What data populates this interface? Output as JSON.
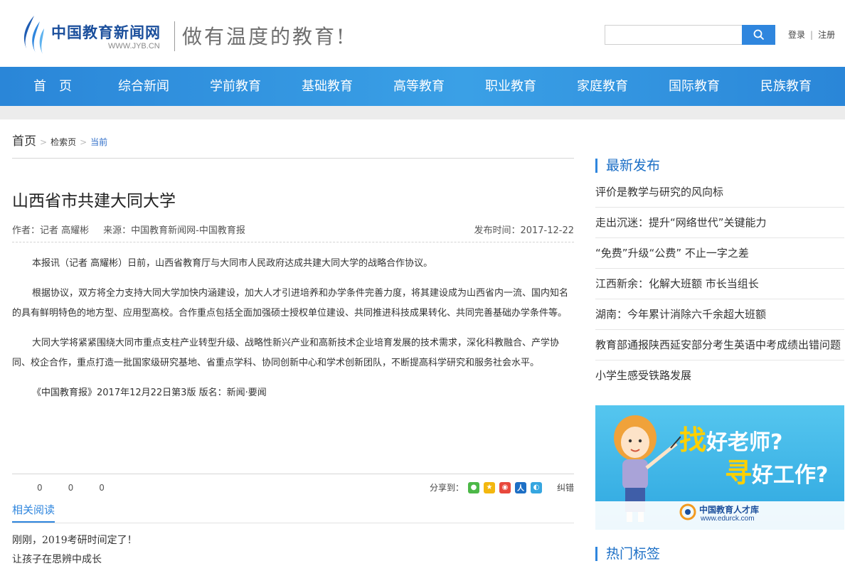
{
  "header": {
    "site_name": "中国教育新闻网",
    "site_url": "WWW.JYB.CN",
    "slogan": "做有温度的教育!",
    "search_placeholder": "",
    "login": "登录",
    "separator": "|",
    "register": "注册"
  },
  "nav": [
    "首　页",
    "综合新闻",
    "学前教育",
    "基础教育",
    "高等教育",
    "职业教育",
    "家庭教育",
    "国际教育",
    "民族教育"
  ],
  "breadcrumb": {
    "home": "首页",
    "search": "检索页",
    "current": "当前"
  },
  "article": {
    "title": "山西省市共建大同大学",
    "author": "作者：记者 高耀彬",
    "source": "来源：中国教育新闻网-中国教育报",
    "pubdate": "发布时间：2017-12-22",
    "paragraphs": [
      "本报讯（记者  高耀彬）日前，山西省教育厅与大同市人民政府达成共建大同大学的战略合作协议。",
      "根据协议，双方将全力支持大同大学加快内涵建设，加大人才引进培养和办学条件完善力度，将其建设成为山西省内一流、国内知名的具有鲜明特色的地方型、应用型高校。合作重点包括全面加强硕士授权单位建设、共同推进科技成果转化、共同完善基础办学条件等。",
      "大同大学将紧紧围绕大同市重点支柱产业转型升级、战略性新兴产业和高新技术企业培育发展的技术需求，深化科教融合、产学协同、校企合作，重点打造一批国家级研究基地、省重点学科、协同创新中心和学术创新团队，不断提高科学研究和服务社会水平。",
      "《中国教育报》2017年12月22日第3版  版名：新闻·要闻"
    ],
    "counts": [
      "0",
      "0",
      "0"
    ],
    "share_label": "分享到：",
    "share_icons": [
      "wechat-icon",
      "qzone-icon",
      "weibo-icon",
      "renren-icon",
      "tencent-weibo-icon"
    ],
    "correct": "纠错"
  },
  "related": {
    "tab": "相关阅读",
    "items": [
      "刚刚，2019考研时间定了！",
      "让孩子在思辨中成长"
    ]
  },
  "sidebar": {
    "latest_title": "最新发布",
    "latest": [
      "评价是教学与研究的风向标",
      "走出沉迷：提升“网络世代”关键能力",
      "“免费”升级“公费”  不止一字之差",
      "江西新余：化解大班额 市长当组长",
      "湖南：今年累计消除六千余超大班额",
      "教育部通报陕西延安部分考生英语中考成绩出错问题",
      "小学生感受铁路发展"
    ],
    "ad": {
      "line1_hl": "找",
      "line1": "好老师?",
      "line2_hl": "寻",
      "line2": "好工作?",
      "brand": "中国教育人才库",
      "url": "www.edurck.com"
    },
    "tags_title": "热门标签"
  },
  "colors": {
    "brand_blue": "#2f86de",
    "nav_blue": "#2a86d8",
    "accent_yellow": "#ffd000"
  }
}
